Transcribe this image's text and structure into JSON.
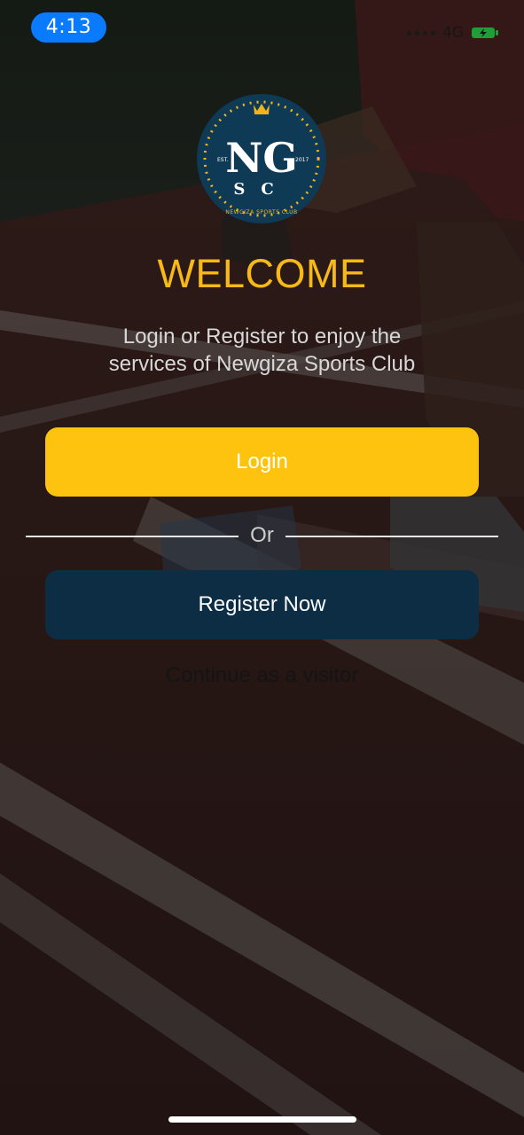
{
  "status_bar": {
    "time": "4:13",
    "network": "4G",
    "icons": [
      "signal-dots-icon",
      "battery-charging-icon"
    ]
  },
  "logo": {
    "monogram_top": "NG",
    "monogram_bottom": "SC",
    "est_left": "EST.",
    "est_right": "2017",
    "ring_text": "NEWGIZA SPORTS CLUB",
    "icon": "crown-icon"
  },
  "welcome": {
    "title": "WELCOME",
    "subtitle": "Login or Register to enjoy the services of Newgiza Sports Club"
  },
  "actions": {
    "login_label": "Login",
    "divider_label": "Or",
    "register_label": "Register Now",
    "visitor_label": "Continue as a visitor"
  },
  "colors": {
    "accent_yellow": "#fdc30e",
    "title_yellow": "#f7b916",
    "navy": "#0c2d44",
    "status_pill": "#0a7aff"
  }
}
